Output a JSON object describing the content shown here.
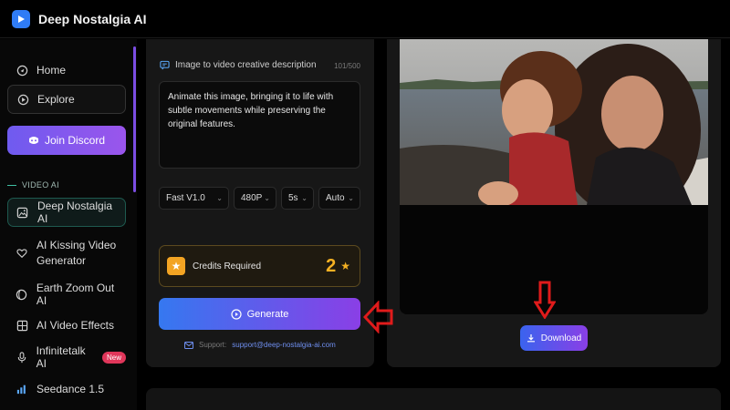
{
  "header": {
    "title": "Deep Nostalgia AI"
  },
  "sidebar": {
    "items": [
      {
        "label": "Home",
        "icon": "home-icon"
      },
      {
        "label": "Explore",
        "icon": "explore-icon"
      }
    ],
    "discord_label": "Join Discord",
    "section_label": "VIDEO AI",
    "video_items": [
      {
        "label": "Deep Nostalgia AI",
        "icon": "image-icon"
      },
      {
        "label": "AI Kissing Video Generator",
        "icon": "heart-icon"
      },
      {
        "label": "Earth Zoom Out AI",
        "icon": "globe-icon"
      },
      {
        "label": "AI Video Effects",
        "icon": "grid-icon"
      },
      {
        "label": "Infinitetalk AI",
        "icon": "microphone-icon",
        "badge": "New"
      },
      {
        "label": "Seedance 1.5",
        "icon": "bars-icon"
      }
    ]
  },
  "editor": {
    "description_label": "Image to video creative description",
    "char_count": "101/500",
    "description_text": "Animate this image, bringing it to life with subtle movements while preserving the original features.",
    "selects": {
      "model": "Fast V1.0",
      "resolution": "480P",
      "duration": "5s",
      "ratio": "Auto"
    },
    "credits_label": "Credits Required",
    "credits_value": "2",
    "generate_label": "Generate",
    "support_label": "Support:",
    "support_email": "support@deep-nostalgia-ai.com"
  },
  "preview": {
    "download_label": "Download"
  },
  "colors": {
    "accent_blue": "#3578f0",
    "accent_purple": "#8a3fe6",
    "credits_gold": "#f5b123",
    "annotation_red": "#e01b1b"
  }
}
